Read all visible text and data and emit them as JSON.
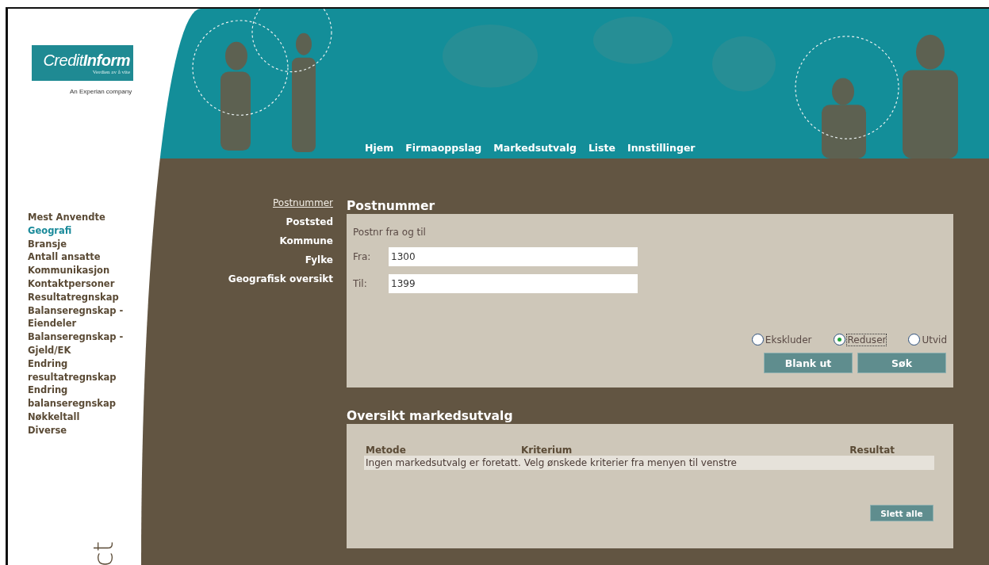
{
  "logo": {
    "name": "Credit**Inform**",
    "tagline": "Verdien av å vite",
    "company": "An Experian company"
  },
  "nav": [
    {
      "label": "Hjem"
    },
    {
      "label": "Firmaoppslag"
    },
    {
      "label": "Markedsutvalg"
    },
    {
      "label": "Liste"
    },
    {
      "label": "Innstillinger"
    }
  ],
  "sidebar": {
    "items": [
      {
        "label": "Mest Anvendte",
        "selected": false
      },
      {
        "label": "Geografi",
        "selected": true
      },
      {
        "label": "Bransje",
        "selected": false
      },
      {
        "label": "Antall ansatte",
        "selected": false
      },
      {
        "label": "Kommunikasjon",
        "selected": false
      },
      {
        "label": "Kontaktpersoner",
        "selected": false
      },
      {
        "label": "Resultatregnskap",
        "selected": false
      },
      {
        "label": "Balanseregnskap - Eiendeler",
        "selected": false
      },
      {
        "label": "Balanseregnskap - Gjeld/EK",
        "selected": false
      },
      {
        "label": "Endring resultatregnskap",
        "selected": false
      },
      {
        "label": "Endring balanseregnskap",
        "selected": false
      },
      {
        "label": "Nøkkeltall",
        "selected": false
      },
      {
        "label": "Diverse",
        "selected": false
      }
    ]
  },
  "subnav": [
    {
      "label": "Postnummer",
      "selected": true
    },
    {
      "label": "Poststed",
      "selected": false
    },
    {
      "label": "Kommune",
      "selected": false
    },
    {
      "label": "Fylke",
      "selected": false
    },
    {
      "label": "Geografisk oversikt",
      "selected": false
    }
  ],
  "postnummer": {
    "title": "Postnummer",
    "hint": "Postnr fra og til",
    "fields": [
      {
        "label": "Fra:",
        "value": "1300"
      },
      {
        "label": "Til:",
        "value": "1399"
      }
    ],
    "options": [
      {
        "label": "Ekskluder",
        "selected": false
      },
      {
        "label": "Reduser",
        "selected": true
      },
      {
        "label": "Utvid",
        "selected": false
      }
    ],
    "buttons": [
      "Blank ut",
      "Søk"
    ]
  },
  "overview": {
    "title": "Oversikt markedsutvalg",
    "columns": [
      "Metode",
      "Kriterium",
      "Resultat"
    ],
    "empty_message": "Ingen markedsutvalg er foretatt. Velg ønskede kriterier fra menyen til venstre",
    "button": "Slett alle"
  },
  "side_text": "ct"
}
